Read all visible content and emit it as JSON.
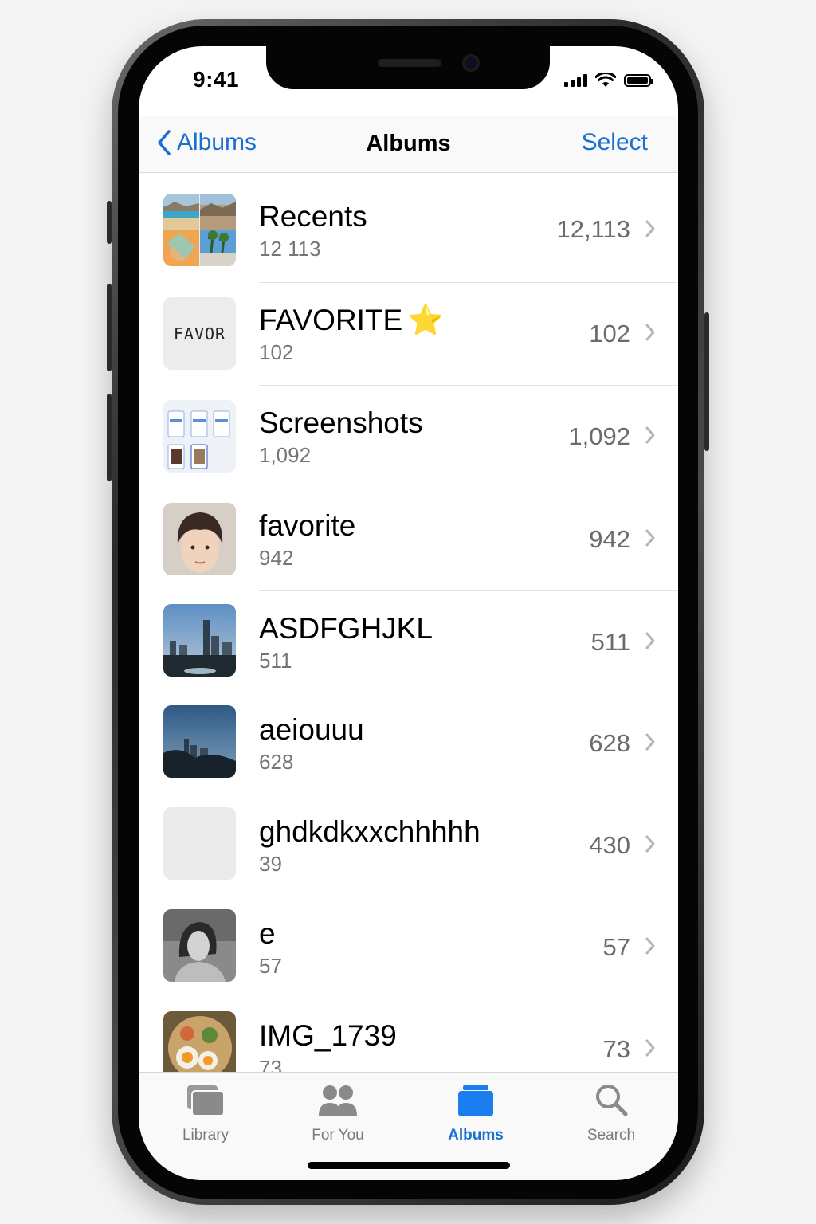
{
  "status_bar": {
    "time": "9:41"
  },
  "nav": {
    "back_label": "Albums",
    "title": "Albums",
    "select_label": "Select",
    "accent_color": "#1a6fd0"
  },
  "albums": [
    {
      "title": "Recents",
      "subtitle": "12 113",
      "count": "12,113",
      "thumb": "landscape-collage"
    },
    {
      "title": "FAVORITE",
      "emoji": "⭐",
      "subtitle": "102",
      "count": "102",
      "thumb_text": "FAVOR"
    },
    {
      "title": "Screenshots",
      "subtitle": "1,092",
      "count": "1,092",
      "thumb": "screenshot-grid"
    },
    {
      "title": "favorite",
      "subtitle": "942",
      "count": "942",
      "thumb": "portrait"
    },
    {
      "title": "ASDFGHJKL",
      "subtitle": "511",
      "count": "511",
      "thumb": "city-skyline"
    },
    {
      "title": "aeiouuu",
      "subtitle": "628",
      "count": "628",
      "thumb": "city-dusk"
    },
    {
      "title": "ghdkdkxxchhhhh",
      "subtitle": "39",
      "count": "430",
      "thumb": "empty"
    },
    {
      "title": "e",
      "subtitle": "57",
      "count": "57",
      "thumb": "bw-portrait"
    },
    {
      "title": "IMG_1739",
      "subtitle": "73",
      "count": "73",
      "thumb": "food"
    }
  ],
  "tabs": [
    {
      "label": "Library",
      "icon": "photo-stack-icon"
    },
    {
      "label": "For You",
      "icon": "people-icon"
    },
    {
      "label": "Albums",
      "icon": "folder-icon",
      "active": true
    },
    {
      "label": "Search",
      "icon": "search-icon"
    }
  ]
}
